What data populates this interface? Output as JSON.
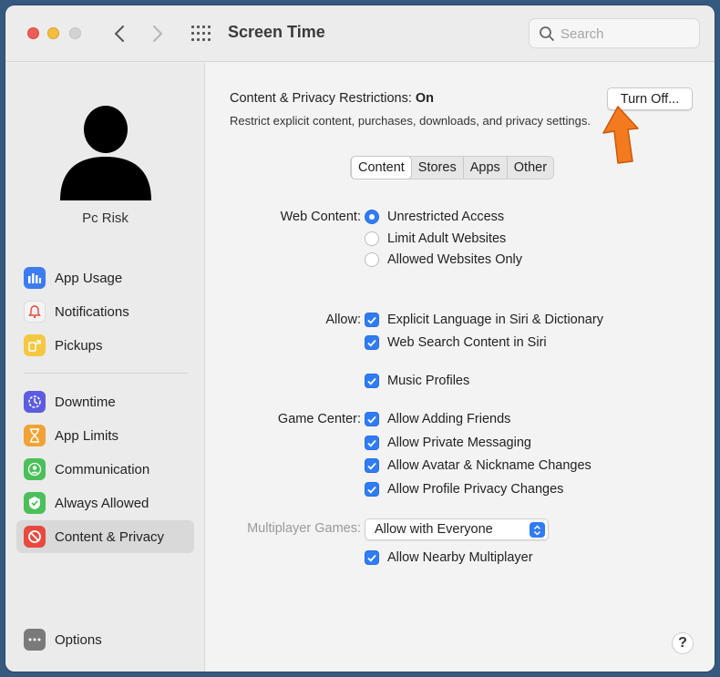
{
  "window": {
    "title": "Screen Time",
    "search_placeholder": "Search"
  },
  "user": {
    "name": "Pc Risk"
  },
  "sidebar": {
    "items": [
      {
        "label": "App Usage",
        "icon": "bar-chart-icon",
        "color": "#3d7cf0"
      },
      {
        "label": "Notifications",
        "icon": "bell-icon",
        "color": "#f2f2f2"
      },
      {
        "label": "Pickups",
        "icon": "pickups-icon",
        "color": "#f6c741"
      },
      {
        "label": "Downtime",
        "icon": "downtime-icon",
        "color": "#5c5ce0"
      },
      {
        "label": "App Limits",
        "icon": "hourglass-icon",
        "color": "#f0a334"
      },
      {
        "label": "Communication",
        "icon": "person-icon",
        "color": "#4bbf5a"
      },
      {
        "label": "Always Allowed",
        "icon": "check-shield-icon",
        "color": "#4bbf5a"
      },
      {
        "label": "Content & Privacy",
        "icon": "no-entry-icon",
        "color": "#e84a3d"
      }
    ],
    "options_label": "Options"
  },
  "restrictions": {
    "title_prefix": "Content & Privacy Restrictions: ",
    "title_state": "On",
    "description": "Restrict explicit content, purchases, downloads, and privacy settings.",
    "turn_off_label": "Turn Off..."
  },
  "tabs": [
    "Content",
    "Stores",
    "Apps",
    "Other"
  ],
  "web_content": {
    "label": "Web Content:",
    "options": [
      "Unrestricted Access",
      "Limit Adult Websites",
      "Allowed Websites Only"
    ],
    "selected": "Unrestricted Access"
  },
  "allow": {
    "label": "Allow:",
    "items": [
      "Explicit Language in Siri & Dictionary",
      "Web Search Content in Siri",
      "Music Profiles"
    ]
  },
  "game_center": {
    "label": "Game Center:",
    "items": [
      "Allow Adding Friends",
      "Allow Private Messaging",
      "Allow Avatar & Nickname Changes",
      "Allow Profile Privacy Changes"
    ]
  },
  "multiplayer": {
    "label": "Multiplayer Games:",
    "selected": "Allow with Everyone",
    "nearby_label": "Allow Nearby Multiplayer"
  },
  "help_label": "?",
  "accent_color": "#2f7cf6"
}
